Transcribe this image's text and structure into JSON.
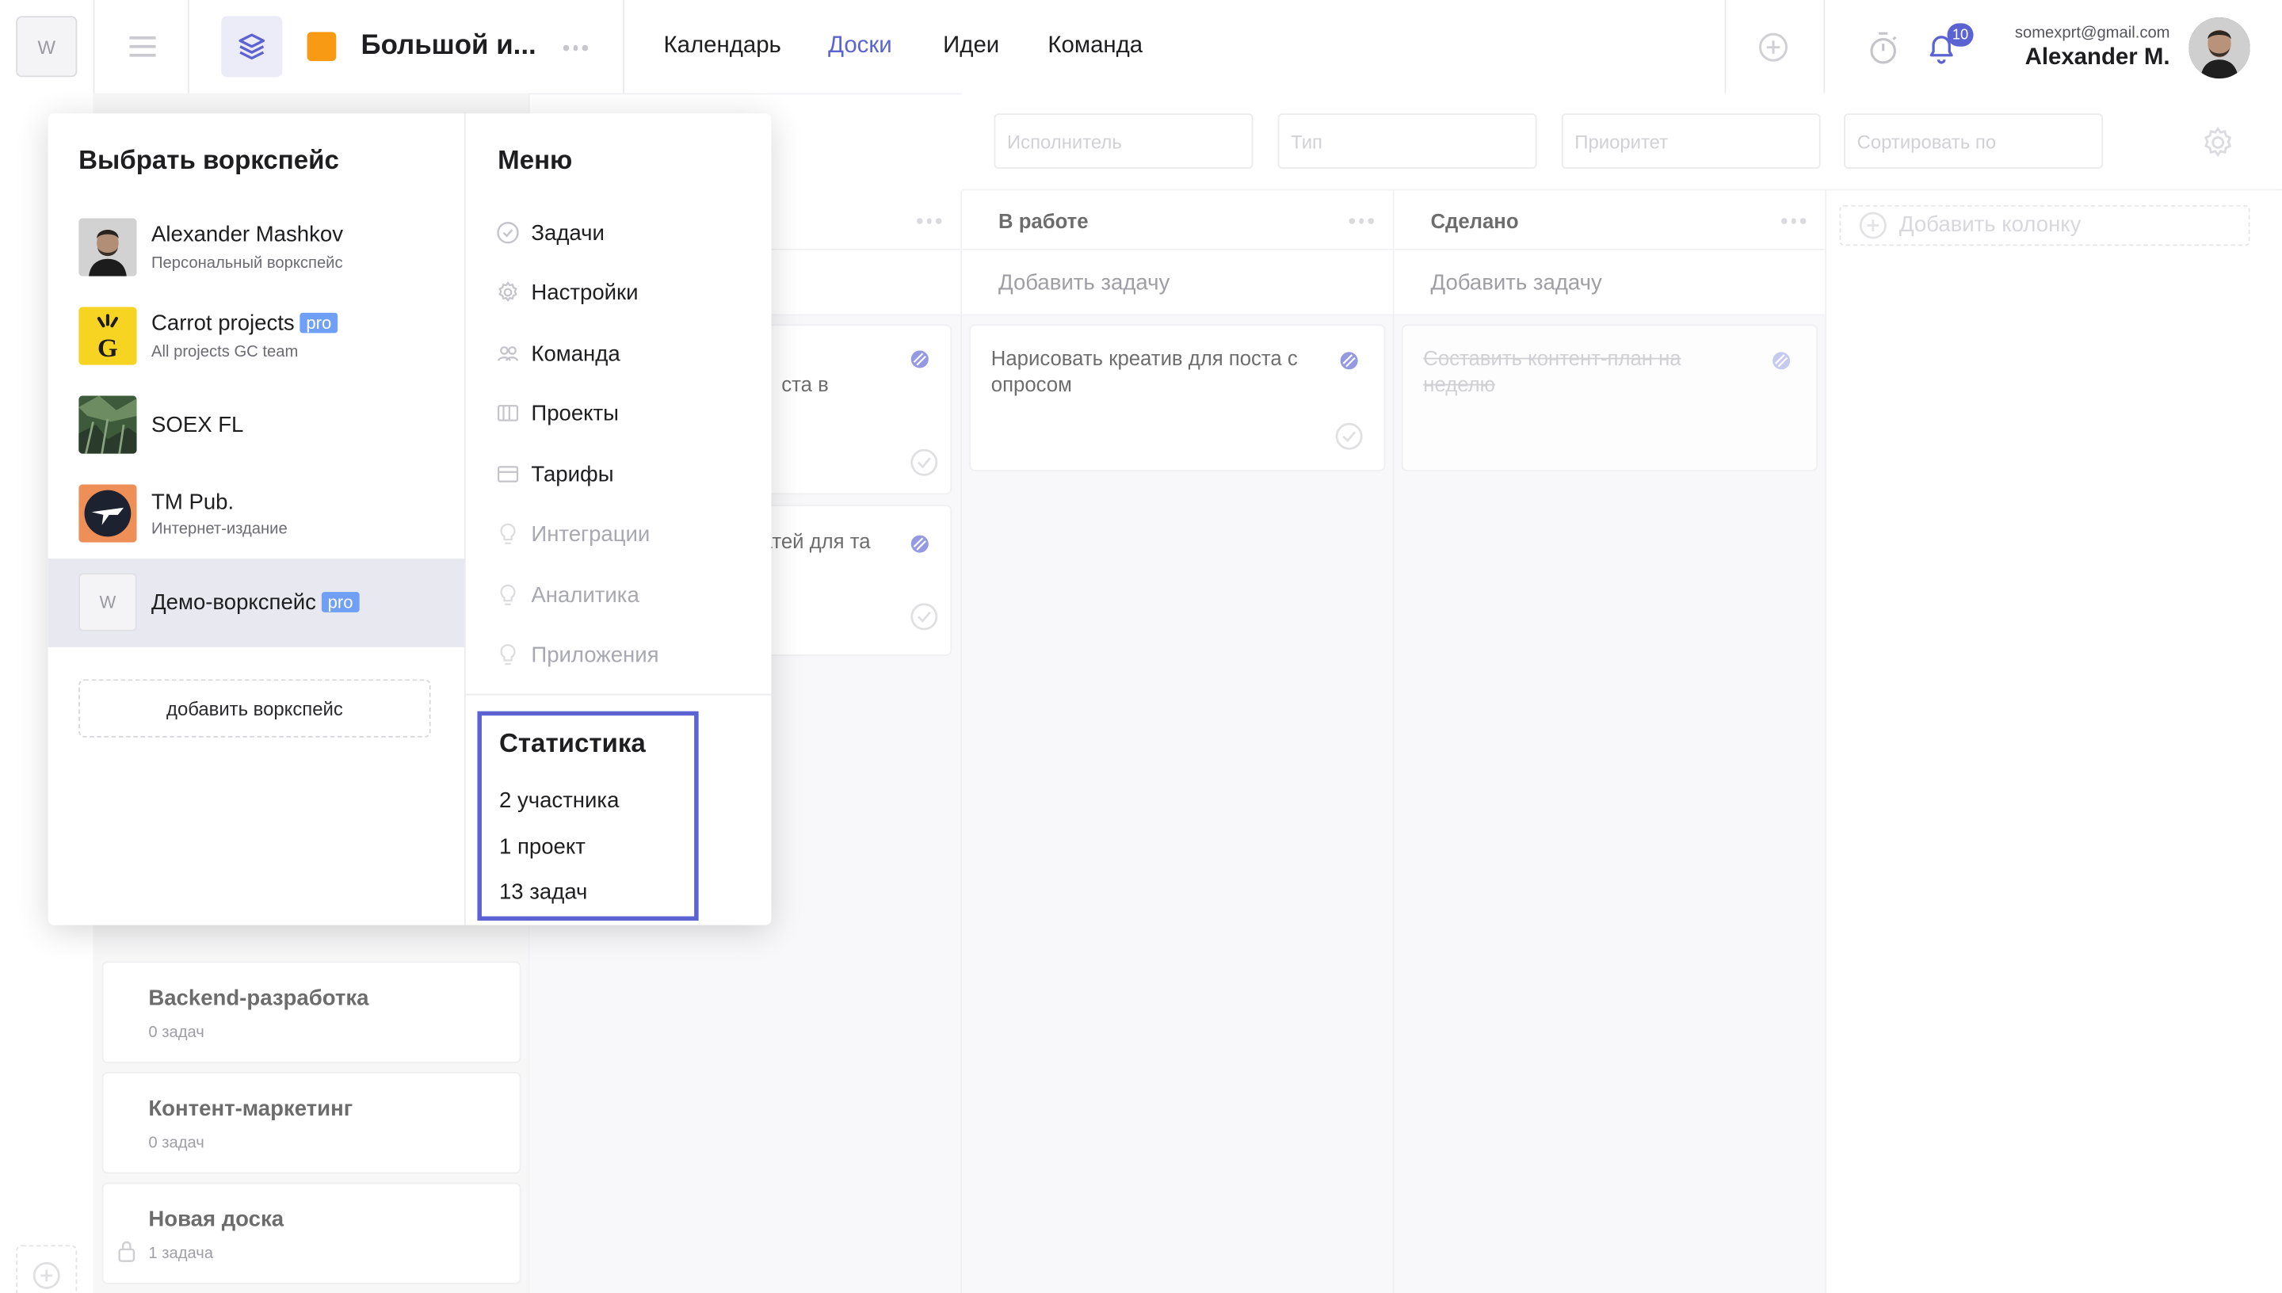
{
  "workspace_button": "W",
  "project": {
    "title": "Большой и...",
    "color": "#f89a13"
  },
  "nav": [
    {
      "label": "Календарь",
      "active": false
    },
    {
      "label": "Доски",
      "active": true
    },
    {
      "label": "Идеи",
      "active": false
    },
    {
      "label": "Команда",
      "active": false
    }
  ],
  "notifications": {
    "count": "10"
  },
  "user": {
    "email": "somexprt@gmail.com",
    "name": "Alexander M."
  },
  "filters": [
    {
      "placeholder": "Исполнитель"
    },
    {
      "placeholder": "Тип"
    },
    {
      "placeholder": "Приоритет"
    },
    {
      "placeholder": "Сортировать по"
    }
  ],
  "columns": [
    {
      "title": "",
      "add_task": "",
      "tasks": [
        {
          "text": "ста в",
          "done": false
        },
        {
          "text": "атей для та",
          "done": false
        }
      ]
    },
    {
      "title": "В работе",
      "add_task": "Добавить задачу",
      "tasks": [
        {
          "text": "Нарисовать креатив для поста с опросом",
          "done": false
        }
      ]
    },
    {
      "title": "Сделано",
      "add_task": "Добавить задачу",
      "tasks": [
        {
          "text": "Составить контент-план на неделю",
          "done": true
        }
      ]
    }
  ],
  "add_column": "Добавить колонку",
  "boards": [
    {
      "title": "Backend-разработка",
      "count": "0 задач",
      "locked": false
    },
    {
      "title": "Контент-маркетинг",
      "count": "0 задач",
      "locked": false
    },
    {
      "title": "Новая доска",
      "count": "1 задача",
      "locked": true
    }
  ],
  "popup": {
    "workspaces_title": "Выбрать воркспейс",
    "workspaces": [
      {
        "name": "Alexander Mashkov",
        "sub": "Персональный воркспейс",
        "pro": false,
        "selected": false,
        "logo": "photo-avatar"
      },
      {
        "name": "Carrot projects",
        "sub": "All projects GC team",
        "pro": true,
        "selected": false,
        "logo": "carrot-logo"
      },
      {
        "name": "SOEX FL",
        "sub": "",
        "pro": false,
        "selected": false,
        "logo": "forest-photo"
      },
      {
        "name": "TM Pub.",
        "sub": "Интернет-издание",
        "pro": false,
        "selected": false,
        "logo": "tm-logo"
      },
      {
        "name": "Демо-воркспейс",
        "sub": "",
        "pro": true,
        "selected": true,
        "logo": "W"
      }
    ],
    "pro_label": "pro",
    "add_workspace": "добавить воркспейс",
    "menu_title": "Меню",
    "menu": [
      {
        "label": "Задачи",
        "icon": "check-circle-icon",
        "enabled": true
      },
      {
        "label": "Настройки",
        "icon": "gear-icon",
        "enabled": true
      },
      {
        "label": "Команда",
        "icon": "team-icon",
        "enabled": true
      },
      {
        "label": "Проекты",
        "icon": "projects-icon",
        "enabled": true
      },
      {
        "label": "Тарифы",
        "icon": "card-icon",
        "enabled": true
      },
      {
        "label": "Интеграции",
        "icon": "bulb-icon",
        "enabled": false
      },
      {
        "label": "Аналитика",
        "icon": "bulb-icon",
        "enabled": false
      },
      {
        "label": "Приложения",
        "icon": "bulb-icon",
        "enabled": false
      }
    ],
    "stats_title": "Статистика",
    "stats": [
      "2 участника",
      "1 проект",
      "13 задач"
    ]
  },
  "colors": {
    "accent": "#5b63d3",
    "pro_badge": "#6fa0f6",
    "project_orange": "#f89a13"
  }
}
